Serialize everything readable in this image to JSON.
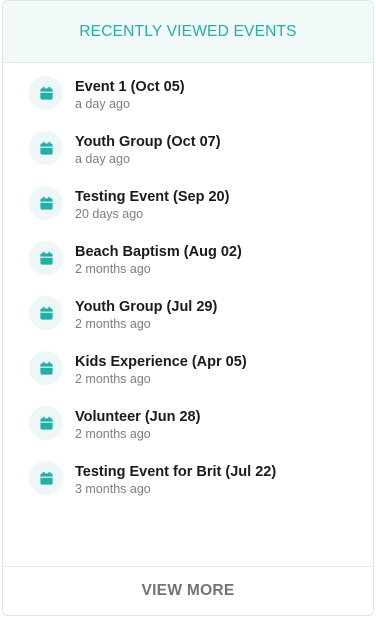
{
  "header": {
    "title": "RECENTLY VIEWED EVENTS"
  },
  "colors": {
    "accent": "#1fb0a8",
    "icon_bg": "#eef7f7",
    "header_bg": "#f2f9f9"
  },
  "events": [
    {
      "title": "Event 1 (Oct 05)",
      "time": "a day ago",
      "icon": "calendar-icon"
    },
    {
      "title": "Youth Group (Oct 07)",
      "time": "a day ago",
      "icon": "calendar-icon"
    },
    {
      "title": "Testing Event (Sep 20)",
      "time": "20 days ago",
      "icon": "calendar-icon"
    },
    {
      "title": "Beach Baptism (Aug 02)",
      "time": "2 months ago",
      "icon": "calendar-icon"
    },
    {
      "title": "Youth Group (Jul 29)",
      "time": "2 months ago",
      "icon": "calendar-icon"
    },
    {
      "title": "Kids Experience (Apr 05)",
      "time": "2 months ago",
      "icon": "calendar-icon"
    },
    {
      "title": "Volunteer (Jun 28)",
      "time": "2 months ago",
      "icon": "calendar-icon"
    },
    {
      "title": "Testing Event for Brit (Jul 22)",
      "time": "3 months ago",
      "icon": "calendar-icon"
    }
  ],
  "footer": {
    "view_more_label": "VIEW MORE"
  }
}
